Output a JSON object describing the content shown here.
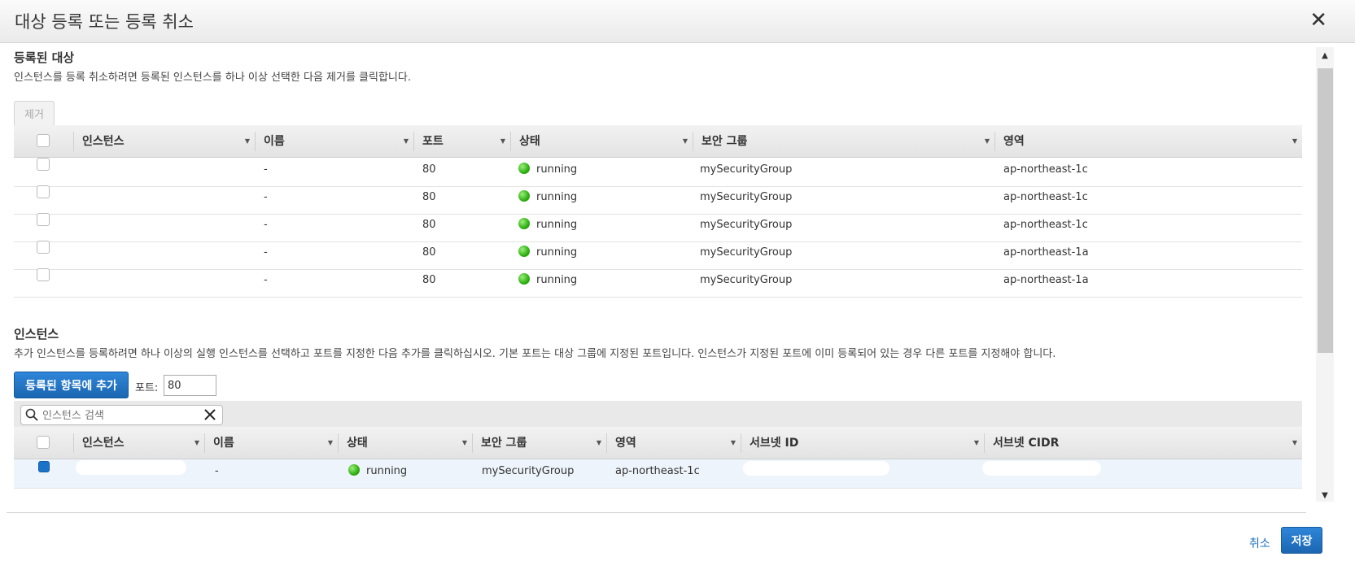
{
  "dialog": {
    "title": "대상 등록 또는 등록 취소"
  },
  "registered": {
    "title": "등록된 대상",
    "description": "인스턴스를 등록 취소하려면 등록된 인스턴스를 하나 이상 선택한 다음 제거를 클릭합니다.",
    "remove_label": "제거",
    "columns": [
      "인스턴스",
      "이름",
      "포트",
      "상태",
      "보안 그룹",
      "영역"
    ],
    "rows": [
      {
        "instance": "",
        "name": "-",
        "port": "80",
        "status": "running",
        "security_group": "mySecurityGroup",
        "zone": "ap-northeast-1c"
      },
      {
        "instance": "",
        "name": "-",
        "port": "80",
        "status": "running",
        "security_group": "mySecurityGroup",
        "zone": "ap-northeast-1c"
      },
      {
        "instance": "",
        "name": "-",
        "port": "80",
        "status": "running",
        "security_group": "mySecurityGroup",
        "zone": "ap-northeast-1c"
      },
      {
        "instance": "",
        "name": "-",
        "port": "80",
        "status": "running",
        "security_group": "mySecurityGroup",
        "zone": "ap-northeast-1a"
      },
      {
        "instance": "",
        "name": "-",
        "port": "80",
        "status": "running",
        "security_group": "mySecurityGroup",
        "zone": "ap-northeast-1a"
      }
    ]
  },
  "instances": {
    "title": "인스턴스",
    "description": "추가 인스턴스를 등록하려면 하나 이상의 실행 인스턴스를 선택하고 포트를 지정한 다음 추가를 클릭하십시오. 기본 포트는 대상 그룹에 지정된 포트입니다. 인스턴스가 지정된 포트에 이미 등록되어 있는 경우 다른 포트를 지정해야 합니다.",
    "add_label": "등록된 항목에 추가",
    "port_label": "포트:",
    "port_value": "80",
    "search_placeholder": "인스턴스 검색",
    "columns": [
      "인스턴스",
      "이름",
      "상태",
      "보안 그룹",
      "영역",
      "서브넷 ID",
      "서브넷 CIDR"
    ],
    "rows": [
      {
        "instance": "",
        "name": "-",
        "status": "running",
        "security_group": "mySecurityGroup",
        "zone": "ap-northeast-1c",
        "subnet_id": "",
        "subnet_cidr": ""
      }
    ]
  },
  "footer": {
    "cancel_label": "취소",
    "save_label": "저장"
  },
  "colors": {
    "accent": "#1b66b2",
    "link": "#1a6fc2",
    "running": "#2eae12"
  }
}
